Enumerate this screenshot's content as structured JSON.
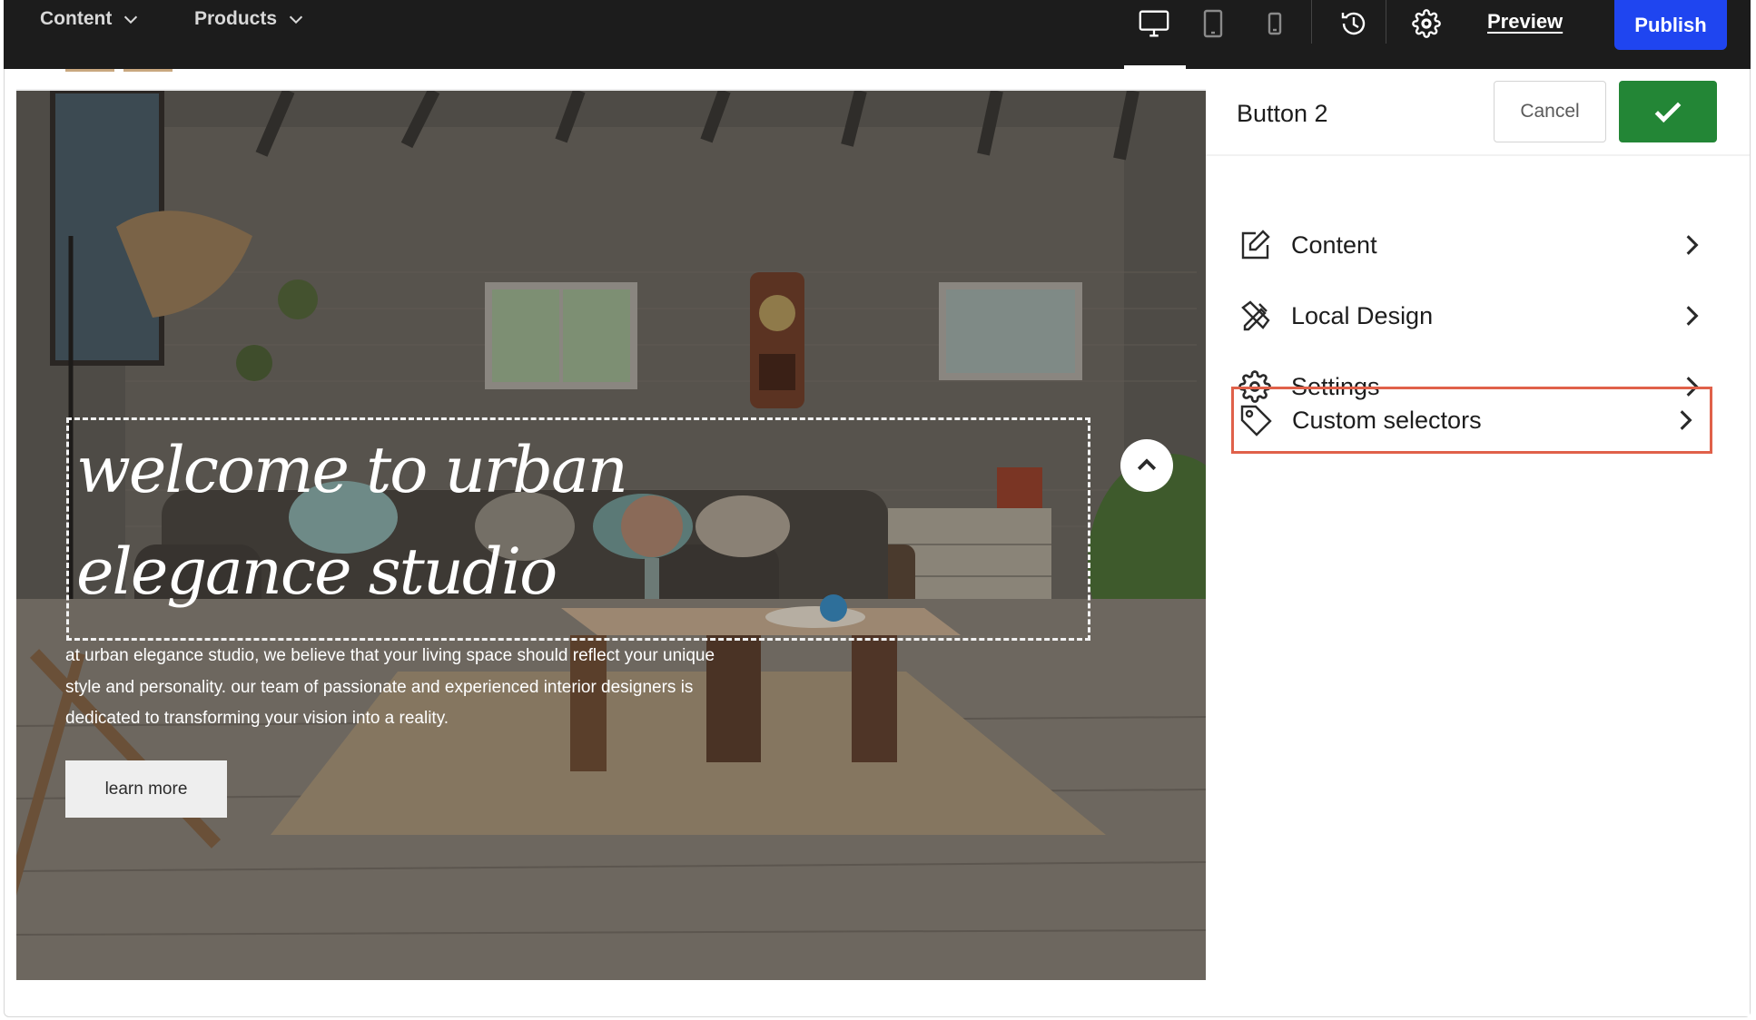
{
  "topbar": {
    "menus": [
      {
        "label": "Content",
        "icon": "chevron-down-icon"
      },
      {
        "label": "Products",
        "icon": "chevron-down-icon"
      }
    ],
    "device_icons": [
      "desktop-icon",
      "tablet-icon",
      "mobile-icon"
    ],
    "active_device": "desktop",
    "history_icon": "history-icon",
    "settings_icon": "gear-icon",
    "preview_label": "Preview",
    "publish_label": "Publish",
    "publish_color": "#1f45f0"
  },
  "hero": {
    "title_line1": "welcome to urban",
    "title_line2": "elegance studio",
    "body": "at urban elegance studio, we believe that your living space should reflect your unique style and personality. our team of passionate and experienced interior designers is dedicated to transforming your vision into a reality.",
    "button_label": "learn more",
    "scroll_icon": "chevron-up-icon"
  },
  "panel": {
    "title": "Button 2",
    "cancel_label": "Cancel",
    "confirm_icon": "checkmark-icon",
    "confirm_color": "#238636",
    "items": [
      {
        "label": "Content",
        "icon": "edit-icon"
      },
      {
        "label": "Local Design",
        "icon": "design-tools-icon"
      },
      {
        "label": "Settings",
        "icon": "gear-icon"
      },
      {
        "label": "Custom selectors",
        "icon": "tag-icon",
        "highlighted": true
      }
    ],
    "highlight_color": "#e0614a"
  }
}
